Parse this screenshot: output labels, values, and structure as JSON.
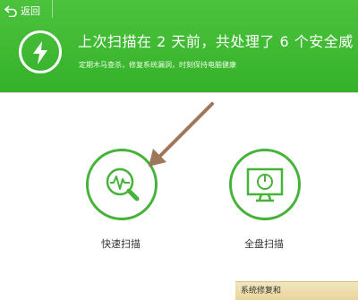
{
  "header": {
    "back_label": "返回",
    "headline": "上次扫描在 2 天前，共处理了 6 个安全威",
    "subline": "定期木马查杀，修复系统漏洞，时刻保持电脑健康"
  },
  "scan": {
    "quick_label": "快速扫描",
    "full_label": "全盘扫描"
  },
  "footer": {
    "repair_label": "系统修复和"
  },
  "colors": {
    "header_green": "#3cb82f",
    "ring_green": "#45b338",
    "annotation_arrow": "#a0765a"
  },
  "icons": {
    "back": "back-arrow-icon",
    "bolt": "lightning-bolt-icon",
    "quick": "magnifier-pulse-icon",
    "full": "monitor-icon"
  }
}
